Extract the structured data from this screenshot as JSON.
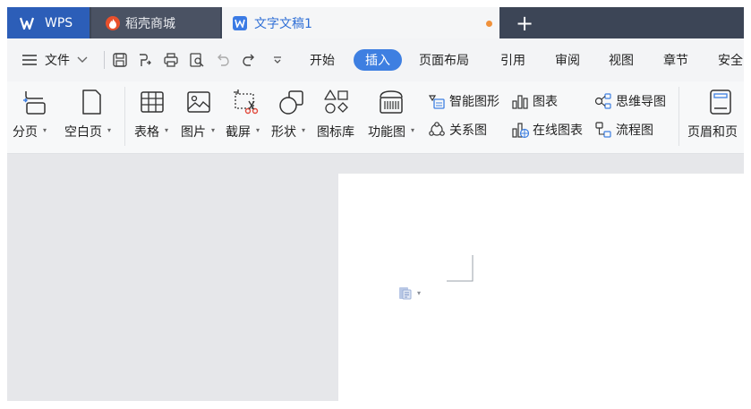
{
  "tabs": {
    "wps_label": "WPS",
    "shop_label": "稻壳商城",
    "doc_label": "文字文稿1",
    "add_label": "+"
  },
  "menu": {
    "file_label": "文件",
    "items": [
      "开始",
      "插入",
      "页面布局",
      "引用",
      "审阅",
      "视图",
      "章节",
      "安全"
    ],
    "active": "插入"
  },
  "ribbon": {
    "page_break": "分页",
    "blank_page": "空白页",
    "table": "表格",
    "picture": "图片",
    "screenshot": "截屏",
    "shape": "形状",
    "icon_lib": "图标库",
    "func_chart": "功能图",
    "smart_art": "智能图形",
    "relation": "关系图",
    "chart": "图表",
    "online_chart": "在线图表",
    "mind_map": "思维导图",
    "flowchart": "流程图",
    "header_footer": "页眉和页"
  },
  "colors": {
    "accent": "#3e7fe1",
    "tabbar": "#3c4556",
    "wps_tab": "#2c5eb8",
    "modified_dot": "#f0913a"
  }
}
